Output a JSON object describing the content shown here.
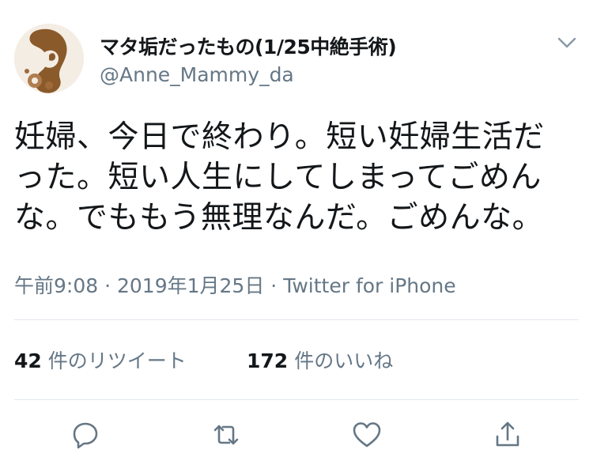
{
  "user": {
    "display_name": "マタ垢だったもの(1/25中絶手術)",
    "handle": "@Anne_Mammy_da"
  },
  "tweet": {
    "lines": [
      "妊婦、今日で終わり。短い妊婦生活だ",
      "った。短い人生にしてしまってごめん",
      "な。でももう無理なんだ。ごめんな。"
    ]
  },
  "meta": {
    "time": "午前9:08",
    "separator1": "·",
    "date": "2019年1月25日",
    "separator2": "·",
    "source": "Twitter for iPhone"
  },
  "stats": {
    "retweets_count": "42",
    "retweets_label": "件のリツイート",
    "likes_count": "172",
    "likes_label": "件のいいね"
  },
  "icons": {
    "menu": "chevron-down-icon",
    "reply": "reply-icon",
    "retweet": "retweet-icon",
    "like": "heart-icon",
    "share": "share-icon"
  },
  "colors": {
    "text": "#14171a",
    "secondary": "#657786",
    "divider": "#e1e8ed",
    "icon": "#657786",
    "avatar_brown": "#8b5a2b"
  }
}
